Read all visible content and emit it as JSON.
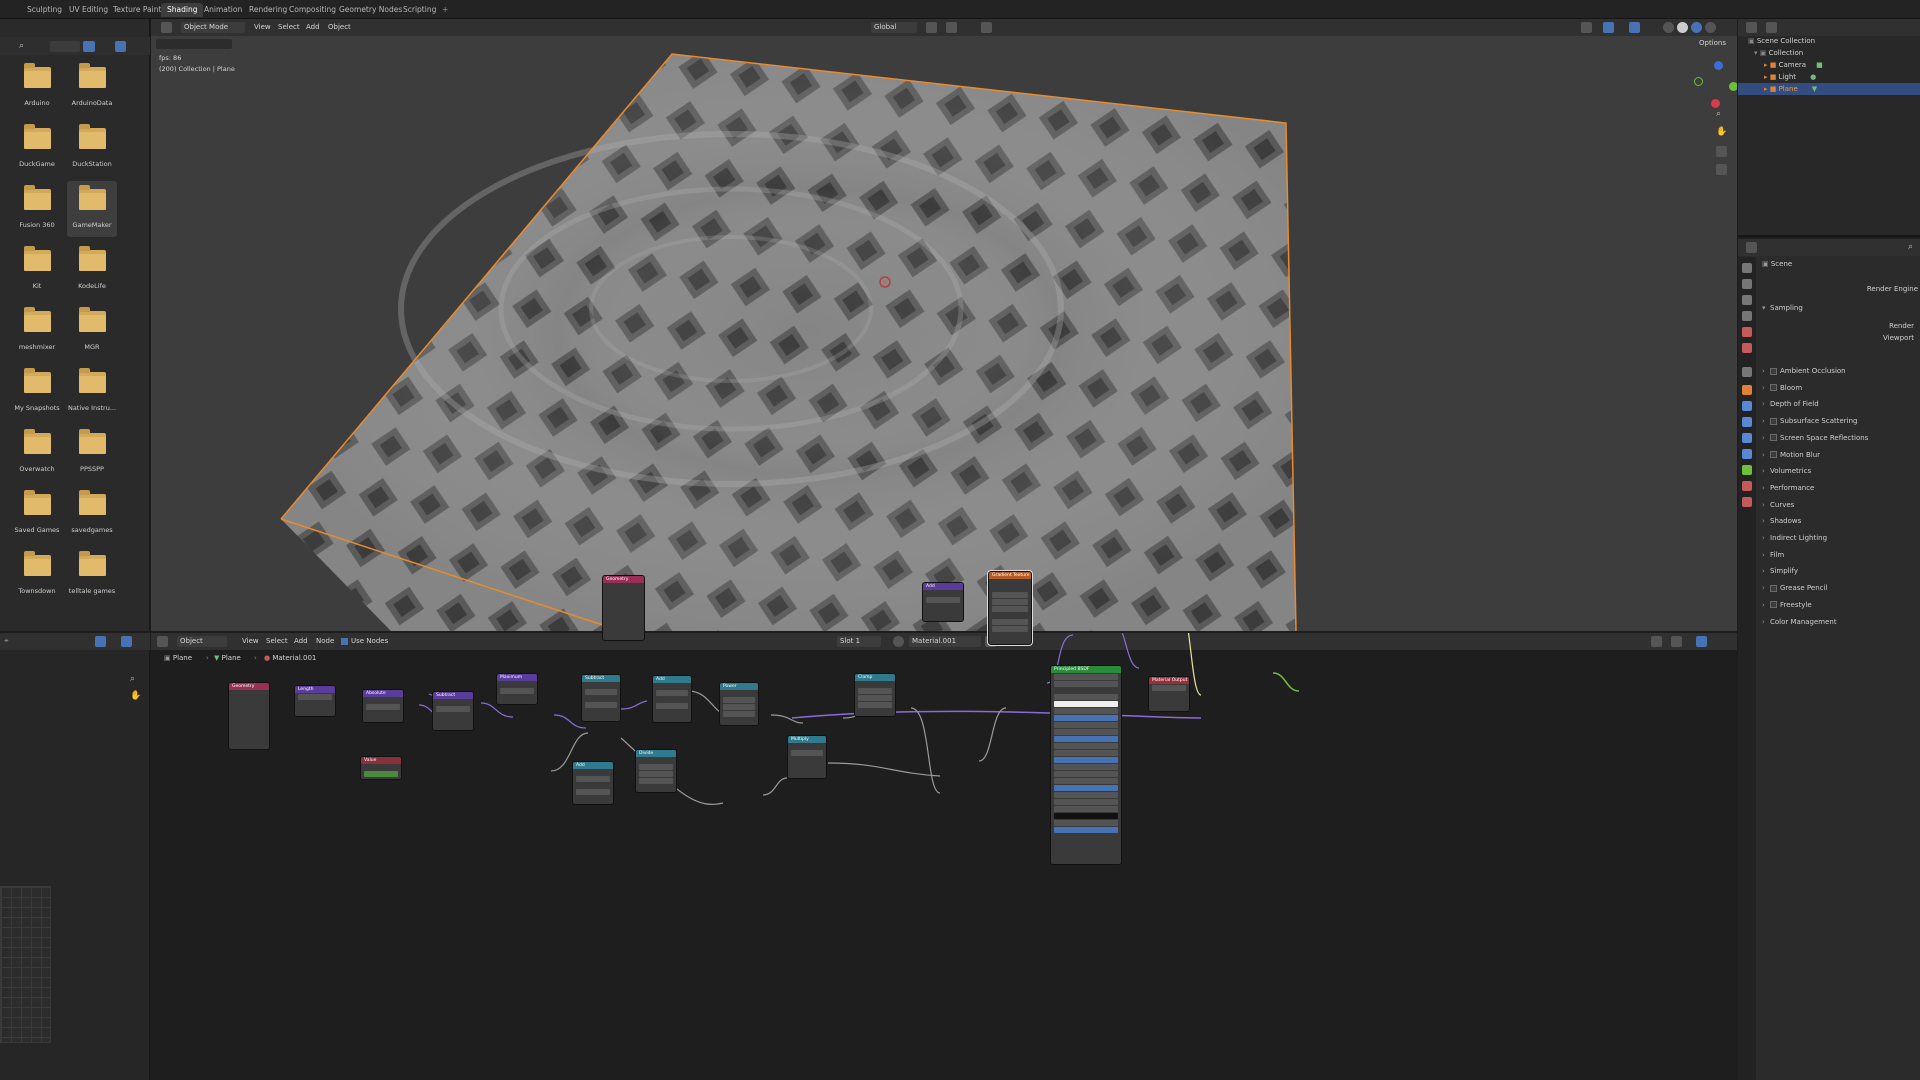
{
  "workspace_tabs": [
    "Sculpting",
    "UV Editing",
    "Texture Paint",
    "Shading",
    "Animation",
    "Rendering",
    "Compositing",
    "Geometry Nodes",
    "Scripting"
  ],
  "active_tab": "Shading",
  "file_browser": {
    "folders": [
      "Arduino",
      "ArduinoData",
      "DuckGame",
      "DuckStation",
      "Fusion 360",
      "GameMaker",
      "Kit",
      "KodeLife",
      "meshmixer",
      "MGR",
      "My Snapshots",
      "Native Instru...",
      "Overwatch",
      "PPSSPP",
      "Saved Games",
      "savedgames",
      "Townsdown",
      "telltale games"
    ],
    "selected": "GameMaker"
  },
  "viewport": {
    "mode": "Object Mode",
    "menu": [
      "View",
      "Select",
      "Add",
      "Object"
    ],
    "transform_orientation": "Global",
    "options_label": "Options",
    "fps_text": "fps: 86",
    "info_text": "(200) Collection | Plane"
  },
  "outliner": {
    "rows": [
      "Scene Collection",
      "Collection",
      "Camera",
      "Light",
      "Plane"
    ],
    "selected": "Plane"
  },
  "properties": {
    "scene_label": "Scene",
    "render_engine_label": "Render Engine",
    "sampling_label": "Sampling",
    "render_label": "Render",
    "viewport_label": "Viewport",
    "panels": [
      "Ambient Occlusion",
      "Bloom",
      "Depth of Field",
      "Subsurface Scattering",
      "Screen Space Reflections",
      "Motion Blur",
      "Volumetrics",
      "Performance",
      "Curves",
      "Shadows",
      "Indirect Lighting",
      "Film",
      "Simplify",
      "Grease Pencil",
      "Freestyle",
      "Color Management"
    ],
    "panels_with_checkbox": [
      "Ambient Occlusion",
      "Bloom",
      "Subsurface Scattering",
      "Screen Space Reflections",
      "Motion Blur",
      "Grease Pencil",
      "Freestyle"
    ]
  },
  "node_editor": {
    "object_label": "Object",
    "menu": [
      "View",
      "Select",
      "Add",
      "Node"
    ],
    "use_nodes_label": "Use Nodes",
    "slot_label": "Slot 1",
    "material_label": "Material.001",
    "breadcrumb": [
      "Plane",
      "Plane",
      "Material.001"
    ]
  }
}
